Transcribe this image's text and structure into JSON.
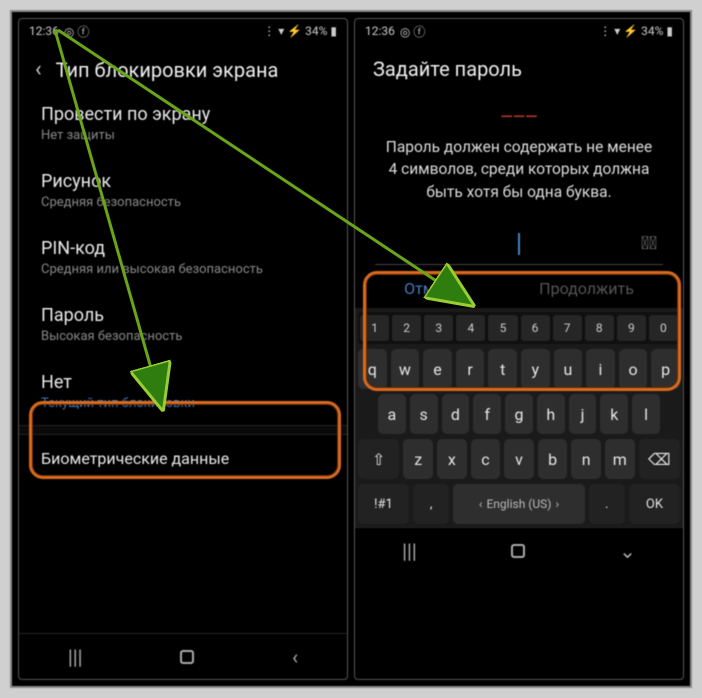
{
  "status": {
    "time": "12:36",
    "icons_left": "◎ ⓕ",
    "icons_right": "⋮ ▾ ⚡ 34% ▮"
  },
  "left": {
    "title": "Тип блокировки экрана",
    "items": [
      {
        "title": "Провести по экрану",
        "sub": "Нет защиты"
      },
      {
        "title": "Рисунок",
        "sub": "Средняя безопасность"
      },
      {
        "title": "PIN-код",
        "sub": "Средняя или высокая безопасность"
      },
      {
        "title": "Пароль",
        "sub": "Высокая безопасность"
      },
      {
        "title": "Нет",
        "sub": "Текущий тип блокировки"
      }
    ],
    "section": "Биометрические данные"
  },
  "right": {
    "title": "Задайте пароль",
    "error": "———",
    "desc": "Пароль должен содержать не менее 4 символов, среди которых должна быть хотя бы одна буква.",
    "cancel": "Отмена",
    "continue": "Продолжить"
  },
  "keyboard": {
    "nums": [
      "1",
      "2",
      "3",
      "4",
      "5",
      "6",
      "7",
      "8",
      "9",
      "0"
    ],
    "row1": [
      "q",
      "w",
      "e",
      "r",
      "t",
      "y",
      "u",
      "i",
      "o",
      "p"
    ],
    "row2": [
      "a",
      "s",
      "d",
      "f",
      "g",
      "h",
      "j",
      "k",
      "l"
    ],
    "row3": [
      "z",
      "x",
      "c",
      "v",
      "b",
      "n",
      "m"
    ],
    "shift": "⇧",
    "bksp": "⌫",
    "sym": "!#1",
    "lang": "English (US)",
    "comma": ",",
    "dot": ".",
    "ok": "OK"
  },
  "nav": {
    "recents": "|||",
    "home": "○",
    "back": "‹"
  }
}
